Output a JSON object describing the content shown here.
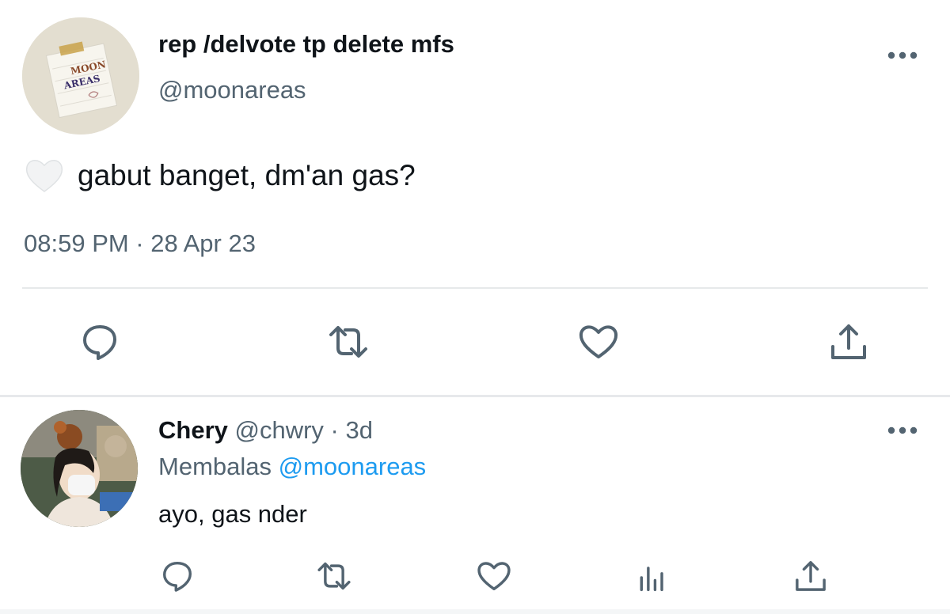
{
  "tweet": {
    "display_name": "rep /delvote tp delete mfs",
    "handle": "@moonareas",
    "text": "gabut banget, dm'an gas?",
    "timestamp": "08:59 PM · 28 Apr 23",
    "avatar_text": [
      "MOON",
      "AREAS"
    ],
    "emoji_icon": "white-heart-emoji",
    "actions": [
      "reply-icon",
      "retweet-icon",
      "like-icon",
      "share-icon"
    ]
  },
  "reply": {
    "display_name": "Chery",
    "meta": "@chwry · 3d",
    "replying_label": "Membalas",
    "replying_to": "@moonareas",
    "text": "ayo, gas nder",
    "actions": [
      "reply-icon",
      "retweet-icon",
      "like-icon",
      "analytics-icon",
      "share-icon"
    ]
  },
  "colors": {
    "text_primary": "#0f1419",
    "text_secondary": "#536471",
    "link": "#1d9bf0",
    "divider": "#e6e9ea"
  }
}
